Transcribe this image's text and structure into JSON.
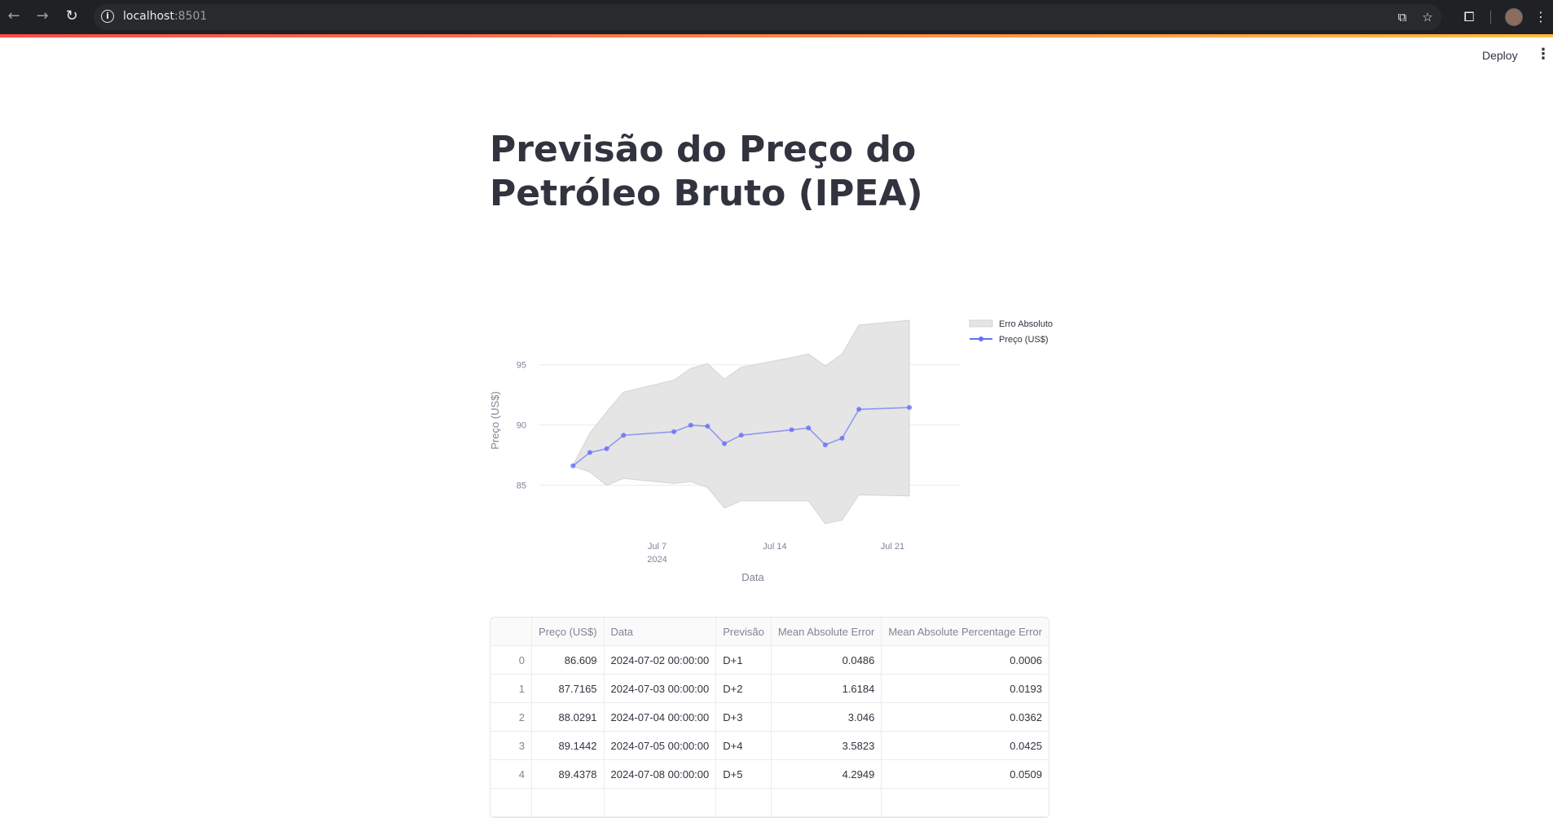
{
  "browser": {
    "url_host": "localhost",
    "url_port": ":8501"
  },
  "app": {
    "deploy_label": "Deploy",
    "title": "Previsão do Preço do Petróleo Bruto (IPEA)"
  },
  "chart_data": {
    "type": "line",
    "xlabel": "Data",
    "ylabel": "Preço (US$)",
    "x_tick_labels": [
      "Jul 7\n2024",
      "Jul 14",
      "Jul 21"
    ],
    "x_ticks": [
      "2024-07-07",
      "2024-07-14",
      "2024-07-21"
    ],
    "y_ticks": [
      85,
      90,
      95
    ],
    "ylim": [
      80.5,
      98.5
    ],
    "xlim": [
      "2024-06-30",
      "2024-07-25"
    ],
    "grid": true,
    "legend_position": "top-right",
    "colors": {
      "line": "#636efa",
      "band": "#e5e5e5"
    },
    "legend": [
      "Erro Absoluto",
      "Preço (US$)"
    ],
    "x": [
      "2024-07-02",
      "2024-07-03",
      "2024-07-04",
      "2024-07-05",
      "2024-07-08",
      "2024-07-09",
      "2024-07-10",
      "2024-07-11",
      "2024-07-12",
      "2024-07-15",
      "2024-07-16",
      "2024-07-17",
      "2024-07-18",
      "2024-07-19",
      "2024-07-22"
    ],
    "series": [
      {
        "name": "Preço (US$)",
        "values": [
          86.609,
          87.7165,
          88.0291,
          89.1442,
          89.4378,
          89.98,
          89.9,
          88.45,
          89.15,
          89.6,
          89.75,
          88.35,
          88.9,
          91.3,
          91.45
        ]
      },
      {
        "name": "Erro Absoluto",
        "upper": [
          86.66,
          89.33,
          91.08,
          92.73,
          93.73,
          94.7,
          95.1,
          93.8,
          94.8,
          95.6,
          95.9,
          94.9,
          95.9,
          98.3,
          98.7
        ],
        "lower": [
          86.56,
          86.1,
          84.98,
          85.56,
          85.14,
          85.3,
          84.8,
          83.1,
          83.7,
          83.7,
          83.7,
          81.8,
          82.1,
          84.2,
          84.1
        ]
      }
    ]
  },
  "table": {
    "columns": [
      "",
      "Preço (US$)",
      "Data",
      "Previsão",
      "Mean Absolute Error",
      "Mean Absolute Percentage Error"
    ],
    "rows": [
      {
        "index": "0",
        "preco": "86.609",
        "data": "2024-07-02 00:00:00",
        "previsao": "D+1",
        "mae": "0.0486",
        "mape": "0.0006"
      },
      {
        "index": "1",
        "preco": "87.7165",
        "data": "2024-07-03 00:00:00",
        "previsao": "D+2",
        "mae": "1.6184",
        "mape": "0.0193"
      },
      {
        "index": "2",
        "preco": "88.0291",
        "data": "2024-07-04 00:00:00",
        "previsao": "D+3",
        "mae": "3.046",
        "mape": "0.0362"
      },
      {
        "index": "3",
        "preco": "89.1442",
        "data": "2024-07-05 00:00:00",
        "previsao": "D+4",
        "mae": "3.5823",
        "mape": "0.0425"
      },
      {
        "index": "4",
        "preco": "89.4378",
        "data": "2024-07-08 00:00:00",
        "previsao": "D+5",
        "mae": "4.2949",
        "mape": "0.0509"
      },
      {
        "index": "",
        "preco": "",
        "data": "",
        "previsao": "",
        "mae": "",
        "mape": ""
      }
    ]
  }
}
